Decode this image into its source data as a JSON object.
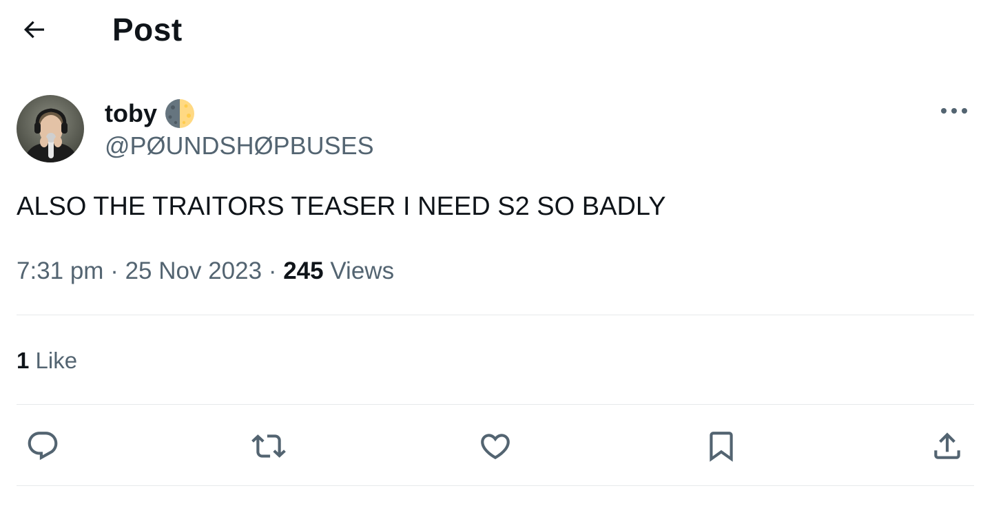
{
  "header": {
    "title": "Post",
    "back_icon": "arrow-left-icon"
  },
  "author": {
    "display_name": "toby",
    "name_emoji": "moon-emoji",
    "handle": "@PØUNDSHØPBUSES",
    "avatar": "avatar-photo"
  },
  "post": {
    "text": "ALSO THE TRAITORS TEASER I NEED S2 SO BADLY",
    "time": "7:31 pm",
    "separator": "·",
    "date": "25 Nov 2023",
    "views_count": "245",
    "views_label": "Views"
  },
  "engagement": {
    "likes_count": "1",
    "likes_label": "Like"
  },
  "actions": [
    "reply-icon",
    "repost-icon",
    "like-icon",
    "bookmark-icon",
    "share-icon"
  ],
  "colors": {
    "text_primary": "#0f1419",
    "text_secondary": "#536471",
    "divider": "#e6e9eb",
    "icon": "#536471"
  }
}
